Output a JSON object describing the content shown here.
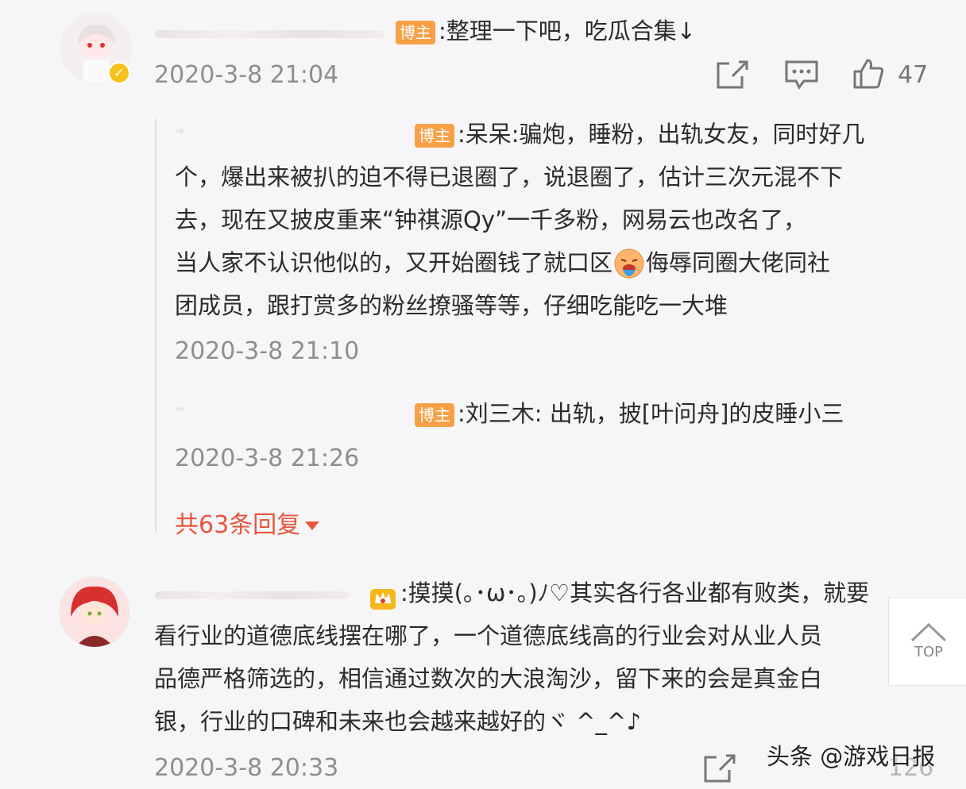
{
  "comments": [
    {
      "badge": "博主",
      "text": ":整理一下吧，吃瓜合集↓",
      "time": "2020-3-8 21:04",
      "likes": "47",
      "replies": [
        {
          "badge": "博主",
          "text_lines": [
            ":呆呆:骗炮，睡粉，出轨女友，同时好几",
            "个，爆出来被扒的迫不得已退圈了，说退圈了，估计三次元混不下",
            "去，现在又披皮重来“钟祺源Qy”一千多粉，网易云也改名了，",
            "当人家不认识他似的，又开始圈钱了就口区",
            "侮辱同圈大佬同社",
            "团成员，跟打赏多的粉丝撩骚等等，仔细吃能吃一大堆"
          ],
          "time": "2020-3-8 21:10"
        },
        {
          "badge": "博主",
          "text": ":刘三木: 出轨，披[叶问舟]的皮睡小三",
          "time": "2020-3-8 21:26"
        }
      ],
      "more_replies": "共63条回复"
    },
    {
      "text_lines": [
        ":摸摸(｡･ω･｡)ﾉ♡其实各行各业都有败类，就要",
        "看行业的道德底线摆在哪了，一个道德底线高的行业会对从业人员",
        "品德严格筛选的，相信通过数次的大浪淘沙，留下来的会是真金白",
        "银，行业的口碑和未来也会越来越好的ヾ ^_^♪"
      ],
      "time": "2020-3-8 20:33",
      "likes": "126"
    }
  ],
  "top_button": "TOP",
  "watermark": "头条 @游戏日报",
  "icons": [
    "share-icon",
    "comment-icon",
    "like-icon",
    "verified-badge-icon",
    "crown-icon",
    "emoji-vomit-icon",
    "chevron-up-icon"
  ]
}
